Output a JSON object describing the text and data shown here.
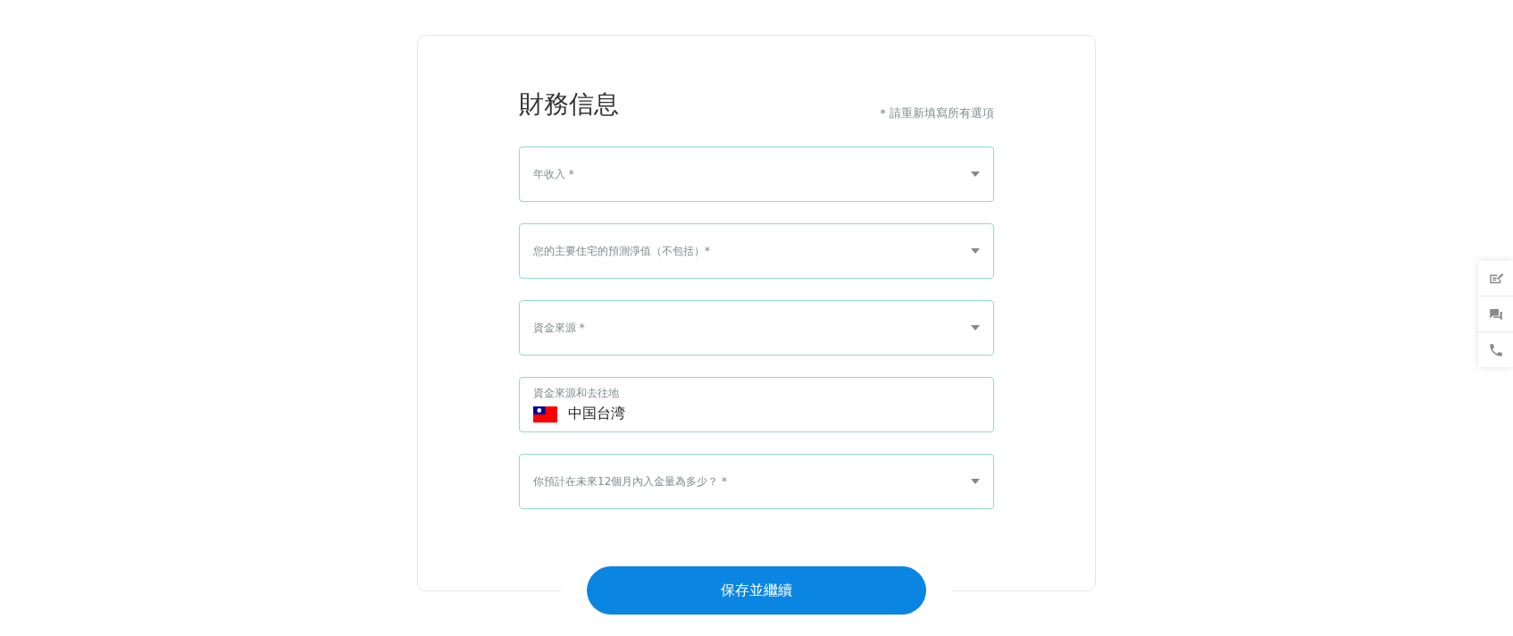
{
  "title": "財務信息",
  "note": "* 請重新填寫所有選項",
  "fields": [
    {
      "kind": "select",
      "label": "年收入 *"
    },
    {
      "kind": "select",
      "label": "您的主要住宅的預測淨值（不包括）*"
    },
    {
      "kind": "select",
      "label": "資金來源 *"
    },
    {
      "kind": "country",
      "label": "資金來源和去往地",
      "value": "中国台湾"
    },
    {
      "kind": "select",
      "label": "你預計在未來12個月內入金量為多少？ *"
    }
  ],
  "submit": "保存並繼續"
}
